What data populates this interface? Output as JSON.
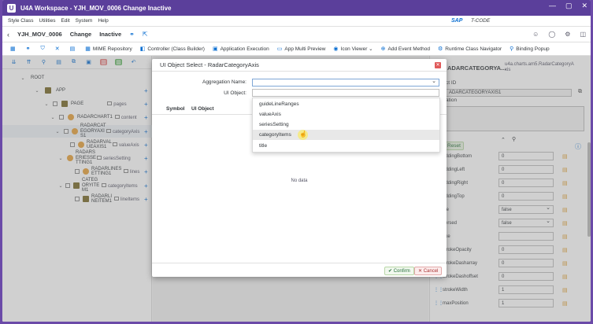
{
  "window": {
    "title": "U4A Workspace - YJH_MOV_0006 Change Inactive",
    "app_icon": "U",
    "btn_minimize": "—",
    "btn_restore": "▢",
    "btn_close": "✕"
  },
  "menu": {
    "items": [
      "Style Class",
      "Utilities",
      "Edit",
      "System",
      "Help"
    ],
    "brand": "SAP",
    "tcode": "T-CODE"
  },
  "header": {
    "back": "‹",
    "app_name": "YJH_MOV_0006",
    "mode": "Change",
    "status": "Inactive",
    "glasses_icon": "⚭",
    "export_icon": "⇱",
    "right_icons": [
      "☺",
      "◯",
      "⚙",
      "◫"
    ]
  },
  "toolbar": {
    "items": [
      {
        "icon": "▦",
        "label": ""
      },
      {
        "icon": "⚭",
        "label": ""
      },
      {
        "icon": "⛉",
        "label": ""
      },
      {
        "icon": "✕",
        "label": ""
      },
      {
        "icon": "▤",
        "label": ""
      },
      {
        "icon": "▦",
        "label": "MIME Repository"
      },
      {
        "icon": "◧",
        "label": "Controller (Class Builder)"
      },
      {
        "icon": "▣",
        "label": "Application Execution"
      },
      {
        "icon": "▭",
        "label": "App Multi Preview"
      },
      {
        "icon": "◉",
        "label": "Icon Viewer ⌄"
      },
      {
        "icon": "⊕",
        "label": "Add Event Method"
      },
      {
        "icon": "⚙",
        "label": "Runtime Class Navigator"
      },
      {
        "icon": "⚲",
        "label": "Binding Popup"
      }
    ]
  },
  "tree_toolbar": {
    "icons": [
      "⇊",
      "⇈",
      "⚲",
      "▤",
      "⧉",
      "▣",
      "▥",
      "▥",
      "↶"
    ]
  },
  "tree": {
    "root": "ROOT",
    "app": "APP",
    "page": "PAGE",
    "page_tag": "pages",
    "radarchart": "RADARCHART1",
    "radarchart_tag": "content",
    "cataxis": "RADARCAT EGORYAXI S1",
    "cataxis_tag": "categoryAxis",
    "valaxis": "RADARVAL UEAXIS1",
    "valaxis_tag": "valueAxis",
    "series": "RADARS ERIESSE TTING1",
    "series_tag": "seriesSetting",
    "lines": "RADARLINES ETTING1",
    "lines_tag": "lines",
    "catitem": "CATEG ORYITE M1",
    "catitem_tag": "categoryItems",
    "lineitem": "RADARLI NEITEM1",
    "lineitem_tag": "lineItems"
  },
  "dialog": {
    "title": "UI Object Select - RadarCategoryAxis",
    "close": "✕",
    "agg_label": "Aggregation Name:",
    "agg_value": "",
    "uiobj_label": "UI Object:",
    "uiobj_value": "",
    "col_symbol": "Symbol",
    "col_uiobject": "UI Object",
    "no_data": "No data",
    "confirm": "✔ Confirm",
    "cancel": "✕ Cancel"
  },
  "dropdown": {
    "options": [
      "guideLineRanges",
      "valueAxis",
      "seriesSetting",
      "categoryItems",
      "title"
    ],
    "highlighted": "categoryItems"
  },
  "right_panel": {
    "close": "✕",
    "title": "ADARCATEGORYA...",
    "subtitle": "u4a.charts.am5.RadarCategoryA xis",
    "object_id_label": "ct ID",
    "object_id_value": "ADARCATEGORYAXIS1",
    "description_label": "ation",
    "reset_label": "Reset",
    "props": [
      {
        "name": "eddingBottom",
        "value": "0",
        "dd": false
      },
      {
        "name": "eddingLeft",
        "value": "0",
        "dd": false
      },
      {
        "name": "eddingRight",
        "value": "0",
        "dd": false
      },
      {
        "name": "eddingTop",
        "value": "0",
        "dd": false
      },
      {
        "name": "ide",
        "value": "false",
        "dd": true
      },
      {
        "name": "versed",
        "value": "false",
        "dd": true
      },
      {
        "name": "oke",
        "value": "",
        "dd": false
      },
      {
        "name": "strokeOpacity",
        "value": "0",
        "dd": false
      },
      {
        "name": "strokeDasharray",
        "value": "0",
        "dd": false
      },
      {
        "name": "strokeDashoffset",
        "value": "0",
        "dd": false
      },
      {
        "name": "strokeWidth",
        "value": "1",
        "dd": false
      },
      {
        "name": "maxPosition",
        "value": "1",
        "dd": false
      }
    ]
  }
}
